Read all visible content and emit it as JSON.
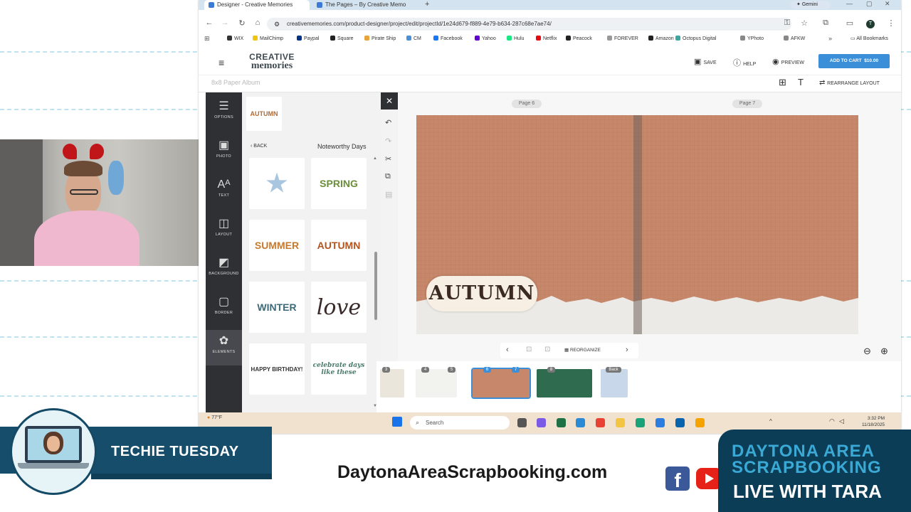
{
  "browser": {
    "tabs": [
      {
        "label": "Designer - Creative Memories"
      },
      {
        "label": "The Pages – By Creative Memo"
      }
    ],
    "gemini_label": "Gemini",
    "profile_initial": "T",
    "url": "creativememories.com/product-designer/project/edit/projectId/1e24d679-f889-4e79-b634-287c68e7ae74/",
    "bookmarks": [
      {
        "label": "WIX",
        "color": "#333333"
      },
      {
        "label": "MailChimp",
        "color": "#f1c40f"
      },
      {
        "label": "Paypal",
        "color": "#003087"
      },
      {
        "label": "Square",
        "color": "#222222"
      },
      {
        "label": "Pirate Ship",
        "color": "#e8a33b"
      },
      {
        "label": "CM",
        "color": "#4a90d9"
      },
      {
        "label": "Facebook",
        "color": "#1877f2"
      },
      {
        "label": "Yahoo",
        "color": "#6001d2"
      },
      {
        "label": "Hulu",
        "color": "#1ce783"
      },
      {
        "label": "Netflix",
        "color": "#e50914"
      },
      {
        "label": "Peacock",
        "color": "#222222"
      },
      {
        "label": "FOREVER",
        "color": "#999999"
      },
      {
        "label": "Amazon",
        "color": "#222222"
      },
      {
        "label": "Octopus Digital",
        "color": "#3ba7a0"
      },
      {
        "label": "YPhoto",
        "color": "#888888"
      },
      {
        "label": "AFKW",
        "color": "#888888"
      }
    ],
    "all_bookmarks": "All Bookmarks"
  },
  "app": {
    "logo_line1": "CREATIVE",
    "logo_line2": "memories",
    "save": "SAVE",
    "help": "HELP",
    "preview": "PREVIEW",
    "add_to_cart": "ADD TO CART",
    "price": "$10.00",
    "album_name": "8x8 Paper Album",
    "rearrange": "REARRANGE LAYOUT",
    "sidebar": [
      {
        "label": "OPTIONS",
        "icon": "sliders-icon",
        "glyph": "☰"
      },
      {
        "label": "PHOTO",
        "icon": "photo-icon",
        "glyph": "▣"
      },
      {
        "label": "TEXT",
        "icon": "text-icon",
        "glyph": "Aᴬ"
      },
      {
        "label": "LAYOUT",
        "icon": "layout-icon",
        "glyph": "◫"
      },
      {
        "label": "BACKGROUND",
        "icon": "background-icon",
        "glyph": "◩"
      },
      {
        "label": "BORDER",
        "icon": "border-icon",
        "glyph": "▢"
      },
      {
        "label": "ELEMENTS",
        "icon": "elements-icon",
        "glyph": "✿"
      }
    ],
    "panel": {
      "back": "BACK",
      "title": "Noteworthy Days",
      "preview_sticker": "AUTUMN",
      "stickers": [
        {
          "label": "",
          "name": "star-sticker"
        },
        {
          "label": "SPRING",
          "name": "spring-sticker"
        },
        {
          "label": "SUMMER",
          "name": "summer-sticker"
        },
        {
          "label": "AUTUMN",
          "name": "autumn-sticker"
        },
        {
          "label": "WINTER",
          "name": "winter-sticker"
        },
        {
          "label": "love",
          "name": "love-sticker"
        },
        {
          "label": "HAPPY BIRTHDAY!",
          "name": "birthday-sticker"
        },
        {
          "label": "celebrate days like these",
          "name": "celebrate-sticker"
        }
      ]
    },
    "pages": {
      "left": "Page 6",
      "right": "Page 7"
    },
    "canvas_sticker": "AUTUMN",
    "reorganize": "REORGANIZE",
    "thumbnails": [
      {
        "num": "3"
      },
      {
        "num": "4"
      },
      {
        "num": "5"
      },
      {
        "num": "6"
      },
      {
        "num": "7"
      },
      {
        "num": "8"
      },
      {
        "num": "Back"
      }
    ]
  },
  "taskbar": {
    "weather_temp": "77°F",
    "search": "Search",
    "time": "3:32 PM",
    "date": "11/18/2025"
  },
  "overlay": {
    "show_title": "TECHIE TUESDAY",
    "website": "DaytonaAreaScrapbooking.com",
    "brand_line1": "DAYTONA AREA",
    "brand_line2": "SCRAPBOOKING",
    "brand_line3": "LIVE WITH TARA"
  }
}
